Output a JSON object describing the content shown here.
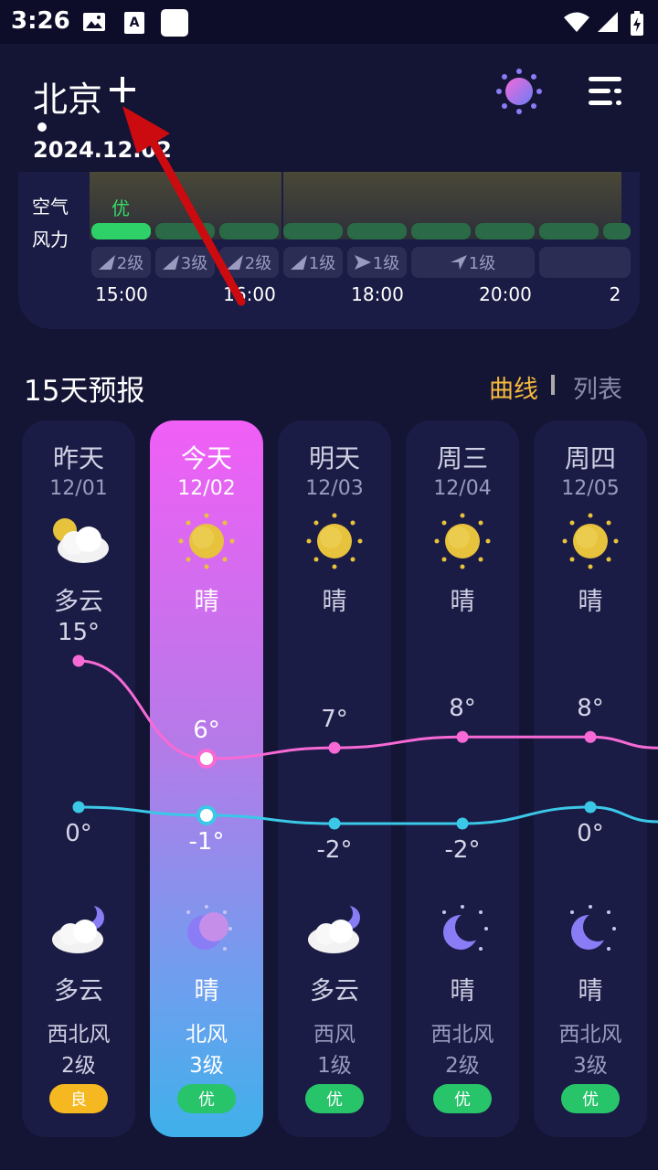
{
  "status_bar": {
    "time": "3:26"
  },
  "header": {
    "city": "北京",
    "date": "2024.12.02"
  },
  "hourly": {
    "air_label": "空气",
    "wind_label": "风力",
    "aqi_text": "优",
    "wind_levels": [
      "2级",
      "3级",
      "2级",
      "1级",
      "1级",
      "1级",
      ""
    ],
    "hours": [
      "15:00",
      "16:00",
      "18:00",
      "20:00",
      "2"
    ]
  },
  "forecast": {
    "title": "15天预报",
    "tab_curve": "曲线",
    "tab_list": "列表",
    "days": [
      {
        "name": "昨天",
        "date": "12/01",
        "day_weather": "多云",
        "night_weather": "多云",
        "wind_dir": "西北风",
        "wind_level": "2级",
        "aqi": "良",
        "high": "15°",
        "low": "0°"
      },
      {
        "name": "今天",
        "date": "12/02",
        "day_weather": "晴",
        "night_weather": "晴",
        "wind_dir": "北风",
        "wind_level": "3级",
        "aqi": "优",
        "high": "6°",
        "low": "-1°"
      },
      {
        "name": "明天",
        "date": "12/03",
        "day_weather": "晴",
        "night_weather": "多云",
        "wind_dir": "西风",
        "wind_level": "1级",
        "aqi": "优",
        "high": "7°",
        "low": "-2°"
      },
      {
        "name": "周三",
        "date": "12/04",
        "day_weather": "晴",
        "night_weather": "晴",
        "wind_dir": "西北风",
        "wind_level": "2级",
        "aqi": "优",
        "high": "8°",
        "low": "-2°"
      },
      {
        "name": "周四",
        "date": "12/05",
        "day_weather": "晴",
        "night_weather": "晴",
        "wind_dir": "西北风",
        "wind_level": "3级",
        "aqi": "优",
        "high": "8°",
        "low": "0°"
      }
    ]
  },
  "colors": {
    "high_curve": "#f76ad6",
    "low_curve": "#3bc8e8",
    "accent": "#f5b93c",
    "aqi_good": "#28c46a",
    "aqi_fair": "#f5b820"
  }
}
